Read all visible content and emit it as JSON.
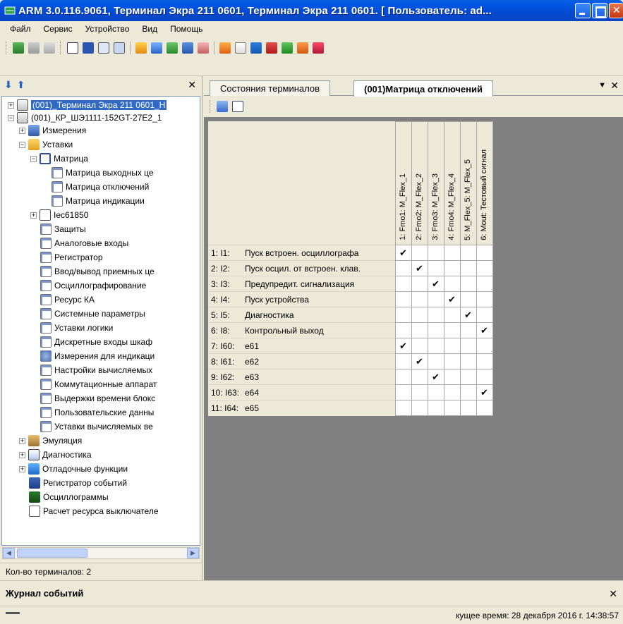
{
  "window": {
    "title": "ARM 3.0.116.9061, Терминал Экра 211 0601, Терминал Экра 211 0601. [ Пользователь: ad..."
  },
  "menu": [
    "Файл",
    "Сервис",
    "Устройство",
    "Вид",
    "Помощь"
  ],
  "left_panel": {
    "tree": [
      {
        "label": "(001)_Терминал Экра 211 0601_Н",
        "icon": "terminal-icon",
        "selected": true
      },
      {
        "label": "(001)_КР_ШЭ1111-152GT-27E2_1",
        "icon": "terminal-icon"
      },
      {
        "label": "Измерения",
        "icon": "measurements-icon"
      },
      {
        "label": "Уставки",
        "icon": "folder-icon"
      },
      {
        "label": "Матрица",
        "icon": "matrix-icon"
      },
      {
        "label": "Матрица выходных це",
        "icon": "document-icon"
      },
      {
        "label": "Матрица отключений",
        "icon": "document-icon"
      },
      {
        "label": "Матрица индикации",
        "icon": "document-icon"
      },
      {
        "label": "Iec61850",
        "icon": "iec-icon"
      },
      {
        "label": "Защиты",
        "icon": "document-icon"
      },
      {
        "label": "Аналоговые входы",
        "icon": "document-icon"
      },
      {
        "label": "Регистратор",
        "icon": "document-icon"
      },
      {
        "label": "Ввод/вывод приемных це",
        "icon": "document-icon"
      },
      {
        "label": "Осциллографирование",
        "icon": "document-icon"
      },
      {
        "label": "Ресурс КА",
        "icon": "document-icon"
      },
      {
        "label": "Системные параметры",
        "icon": "document-icon"
      },
      {
        "label": "Уставки логики",
        "icon": "document-icon"
      },
      {
        "label": "Дискретные входы шкаф",
        "icon": "document-icon"
      },
      {
        "label": "Измерения для индикаци",
        "icon": "meter-icon"
      },
      {
        "label": "Настройки вычисляемых",
        "icon": "document-icon"
      },
      {
        "label": "Коммутационные аппарат",
        "icon": "document-icon"
      },
      {
        "label": "Выдержки времени блокс",
        "icon": "document-icon"
      },
      {
        "label": "Пользовательские данны",
        "icon": "document-icon"
      },
      {
        "label": "Уставки вычисляемых ве",
        "icon": "document-icon"
      },
      {
        "label": "Эмуляция",
        "icon": "emulation-icon"
      },
      {
        "label": "Диагностика",
        "icon": "diagnostics-icon"
      },
      {
        "label": "Отладочные функции",
        "icon": "debug-icon"
      },
      {
        "label": "Регистратор событий",
        "icon": "event-log-icon"
      },
      {
        "label": "Осциллограммы",
        "icon": "oscillogram-icon"
      },
      {
        "label": "Расчет ресурса выключателе",
        "icon": "calc-icon"
      }
    ],
    "terminal_count": "Кол-во терминалов: 2"
  },
  "tabs": [
    {
      "label": "Состояния терминалов"
    },
    {
      "label": "(001)Матрица отключений"
    }
  ],
  "matrix": {
    "columns": [
      "1: Fmo1: M_Flex_1",
      "2: Fmo2: M_Flex_2",
      "3: Fmo3: M_Flex_3",
      "4: Fmo4: M_Flex_4",
      "5: M_Flex_5: M_Flex_5",
      "6: Mout: Тестовый сигнал"
    ],
    "rows": [
      {
        "id": "1: I1:",
        "name": "Пуск встроен. осциллографа",
        "checks": [
          1,
          0,
          0,
          0,
          0,
          0
        ]
      },
      {
        "id": "2: I2:",
        "name": "Пуск осцил. от встроен. клав.",
        "checks": [
          0,
          1,
          0,
          0,
          0,
          0
        ]
      },
      {
        "id": "3: I3:",
        "name": "Предупредит. сигнализация",
        "checks": [
          0,
          0,
          1,
          0,
          0,
          0
        ]
      },
      {
        "id": "4: I4:",
        "name": "Пуск устройства",
        "checks": [
          0,
          0,
          0,
          1,
          0,
          0
        ]
      },
      {
        "id": "5: I5:",
        "name": "Диагностика",
        "checks": [
          0,
          0,
          0,
          0,
          1,
          0
        ]
      },
      {
        "id": "6: I8:",
        "name": "Контрольный выход",
        "checks": [
          0,
          0,
          0,
          0,
          0,
          1
        ]
      },
      {
        "id": "7: I60:",
        "name": "e61",
        "checks": [
          1,
          0,
          0,
          0,
          0,
          0
        ]
      },
      {
        "id": "8: I61:",
        "name": "e62",
        "checks": [
          0,
          1,
          0,
          0,
          0,
          0
        ]
      },
      {
        "id": "9: I62:",
        "name": "e63",
        "checks": [
          0,
          0,
          1,
          0,
          0,
          0
        ]
      },
      {
        "id": "10: I63:",
        "name": "e64",
        "checks": [
          0,
          0,
          0,
          0,
          0,
          1
        ]
      },
      {
        "id": "11: I64:",
        "name": "e65",
        "checks": [
          0,
          0,
          0,
          0,
          0,
          0
        ]
      }
    ],
    "check_glyph": "✔"
  },
  "journal": {
    "title": "Журнал событий"
  },
  "status": {
    "time_text": "кущее время: 28 декабря 2016 г. 14:38:57"
  },
  "colors": {
    "title_bar": "#0449d2",
    "selection": "#316ac5",
    "grid_bg": "#808080"
  }
}
